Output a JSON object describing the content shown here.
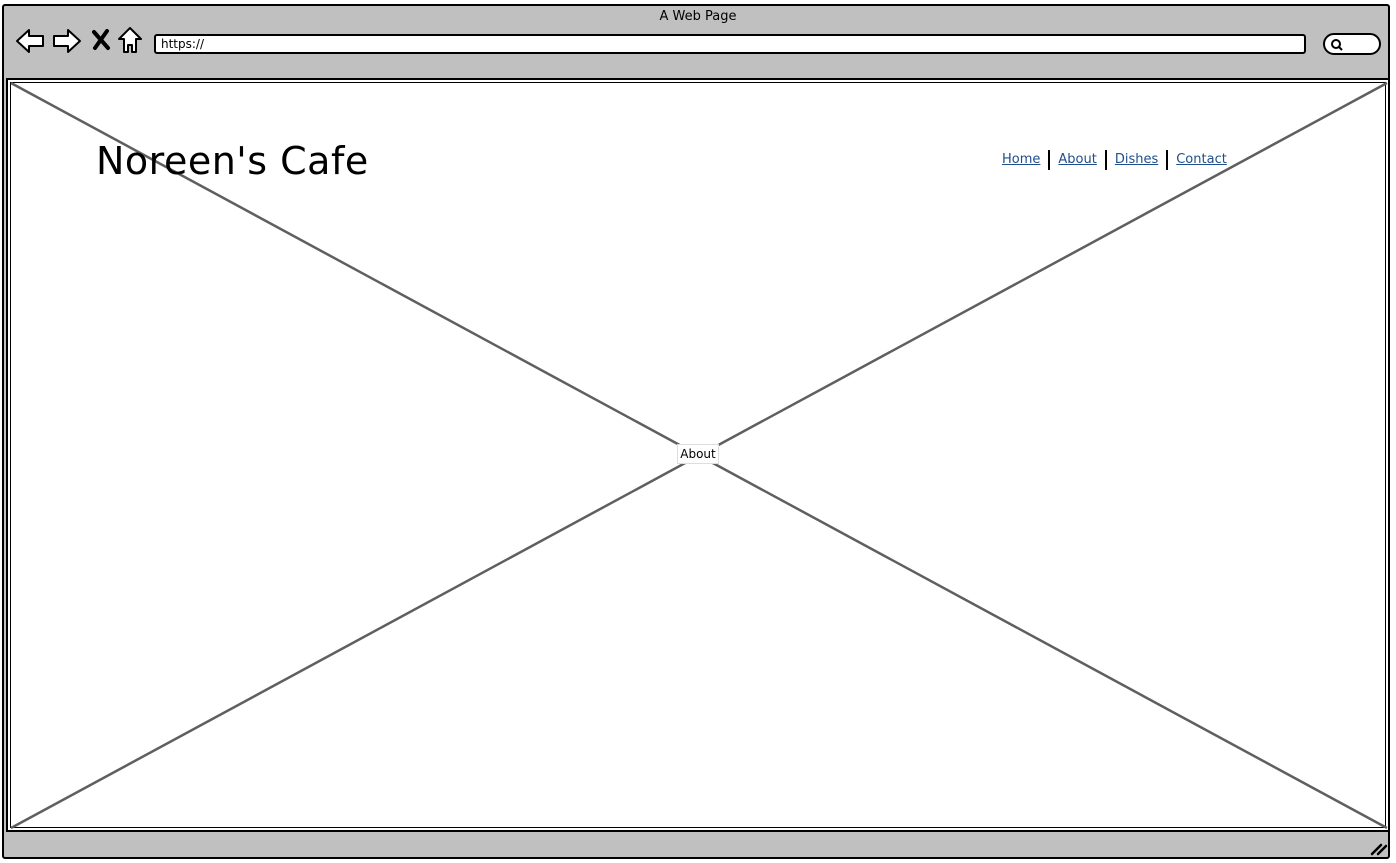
{
  "browser": {
    "title": "A Web Page",
    "url": "https://",
    "nav_buttons": [
      "back-icon",
      "forward-icon",
      "close-icon",
      "home-icon"
    ],
    "search_icon": "search-icon"
  },
  "page": {
    "site_title": "Noreen's Cafe",
    "nav": [
      {
        "label": "Home"
      },
      {
        "label": "About"
      },
      {
        "label": "Dishes"
      },
      {
        "label": "Contact"
      }
    ],
    "image_placeholder_label": "About",
    "link_color": "#1f4e8c"
  }
}
